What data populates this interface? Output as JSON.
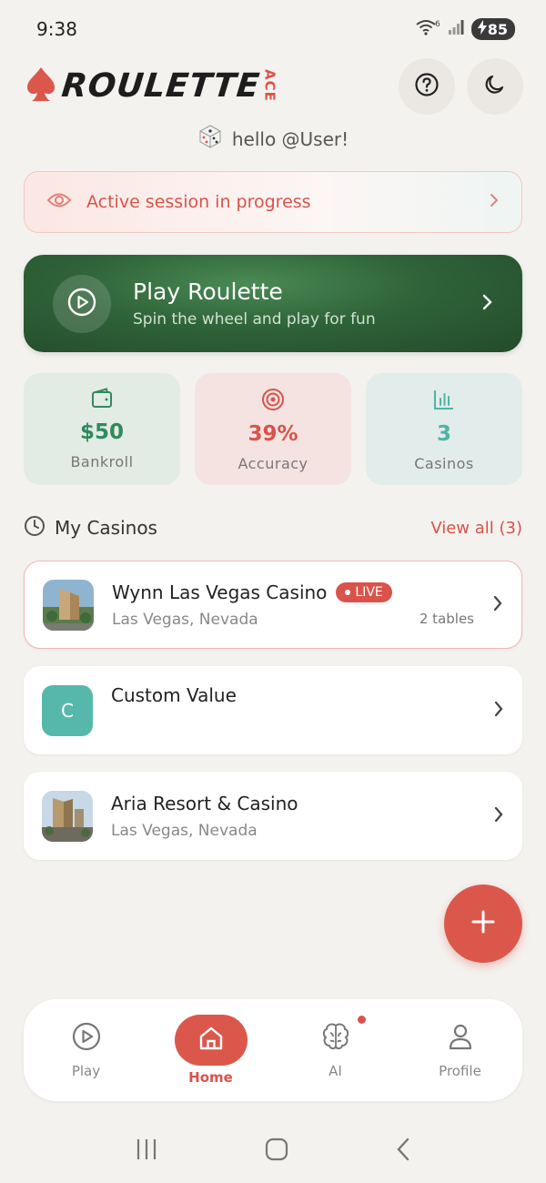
{
  "status_bar": {
    "time": "9:38",
    "battery": "85",
    "wifi_badge": "6"
  },
  "header": {
    "logo_text": "ROULETTE",
    "logo_accent": "ACE",
    "help_icon": "question-circle-icon",
    "theme_icon": "moon-icon"
  },
  "greeting": {
    "text": "hello @User!",
    "icon": "dice-icon"
  },
  "session_banner": {
    "text": "Active session in progress"
  },
  "play_card": {
    "title": "Play Roulette",
    "subtitle": "Spin the wheel and play for fun"
  },
  "stats": [
    {
      "value": "$50",
      "label": "Bankroll",
      "icon": "wallet-icon",
      "color": "#2f8a5c",
      "bg": "#e3ebe5"
    },
    {
      "value": "39%",
      "label": "Accuracy",
      "icon": "target-icon",
      "color": "#d9534a",
      "bg": "#f4e3e1"
    },
    {
      "value": "3",
      "label": "Casinos",
      "icon": "bar-chart-icon",
      "color": "#4fb3a8",
      "bg": "#e2ecea"
    }
  ],
  "casinos_section": {
    "title": "My Casinos",
    "view_all": "View all (3)"
  },
  "casinos": [
    {
      "name": "Wynn Las Vegas Casino",
      "badge": "LIVE",
      "location": "Las Vegas, Nevada",
      "tables": "2 tables"
    },
    {
      "name": "Custom Value",
      "initial": "C"
    },
    {
      "name": "Aria Resort & Casino",
      "location": "Las Vegas, Nevada"
    }
  ],
  "bottom_nav": [
    {
      "label": "Play",
      "icon": "play-circle-icon"
    },
    {
      "label": "Home",
      "icon": "home-icon"
    },
    {
      "label": "AI",
      "icon": "brain-icon"
    },
    {
      "label": "Profile",
      "icon": "user-icon"
    }
  ],
  "colors": {
    "accent": "#d9534a",
    "green": "#2f6338",
    "teal": "#4fb3a8",
    "background": "#f4f2ef"
  }
}
